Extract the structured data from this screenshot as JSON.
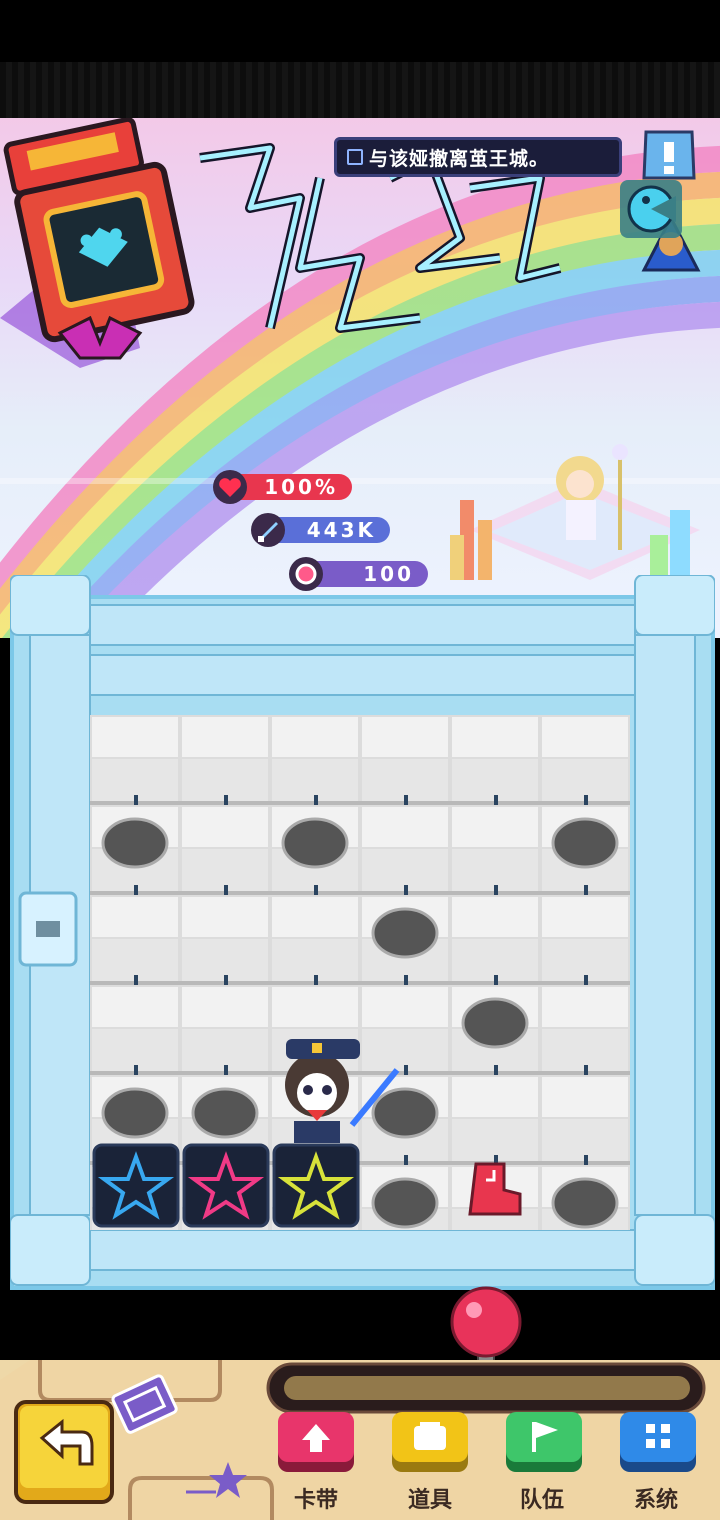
{
  "quest": {
    "text": "与该娅撤离茧王城。"
  },
  "stats": {
    "hp": "100%",
    "attack": "443K",
    "energy": "100"
  },
  "nav": {
    "cards": "卡带",
    "items": "道具",
    "team": "队伍",
    "system": "系统"
  },
  "colors": {
    "hp": "#e8364e",
    "attack": "#5a6fd8",
    "energy": "#7a5cc8",
    "cards": "#e8356b",
    "items": "#f2c417",
    "team": "#3ec66a",
    "system": "#2f8ae8"
  }
}
